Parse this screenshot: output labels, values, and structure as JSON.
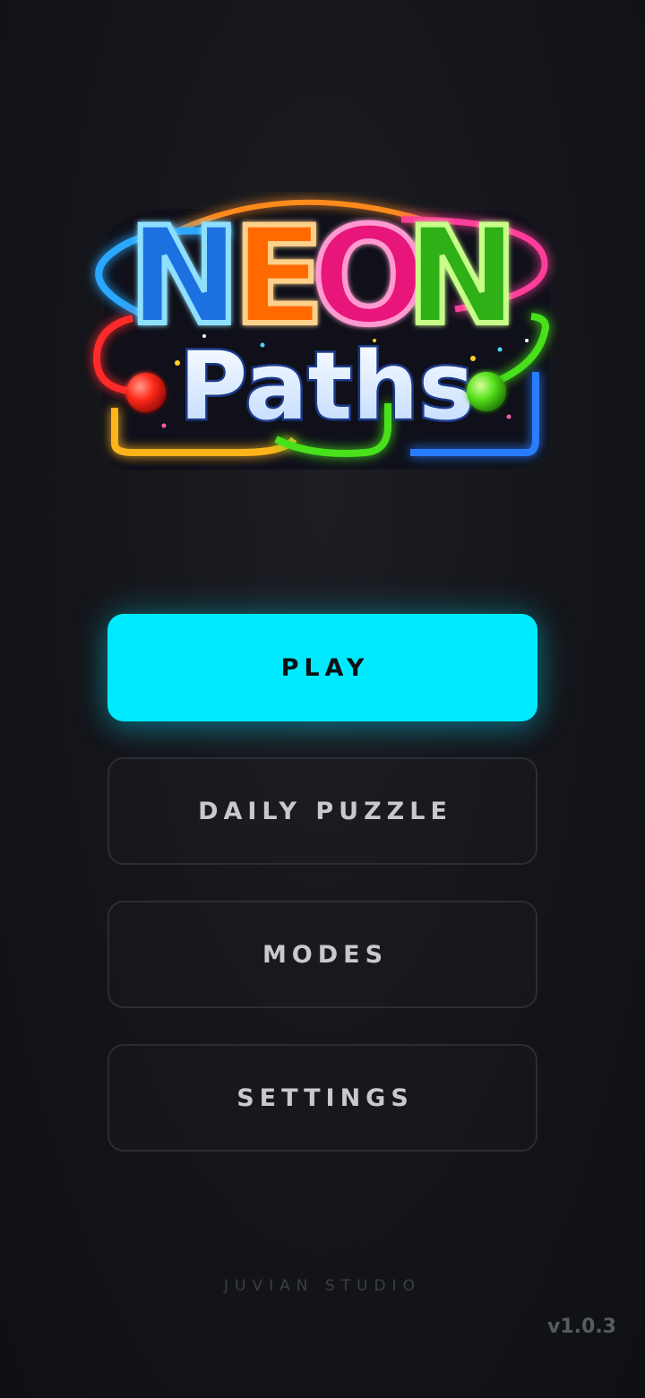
{
  "logo": {
    "word_top": [
      "N",
      "E",
      "O",
      "N"
    ],
    "word_bottom": "Paths",
    "colors": {
      "blue": "#2aa8ff",
      "orange": "#ff8a1e",
      "pink": "#ff3c9a",
      "green": "#3fd81e",
      "red": "#ff2a2a",
      "yellow": "#ffd21e"
    }
  },
  "menu": {
    "play_label": "PLAY",
    "daily_label": "DAILY PUZZLE",
    "modes_label": "MODES",
    "settings_label": "SETTINGS"
  },
  "footer": {
    "studio": "JUVIAN STUDIO",
    "version": "v1.0.3"
  },
  "theme": {
    "accent": "#00eaff",
    "background": "#121318"
  }
}
